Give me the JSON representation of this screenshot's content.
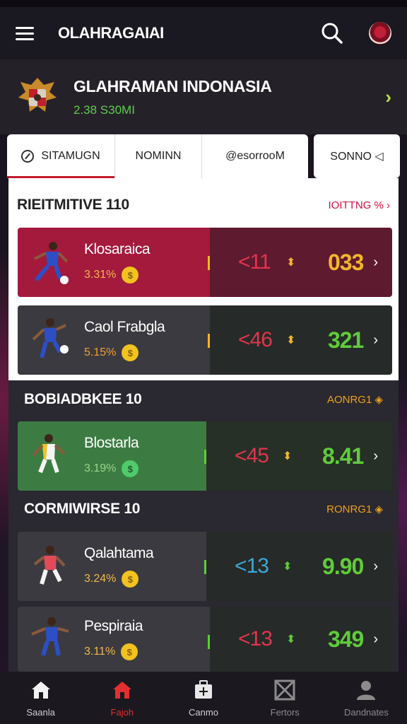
{
  "app": {
    "title": "OLAHRAGAIAI",
    "menu_icon": "menu-icon",
    "search_icon": "search-icon",
    "profile_icon": "profile-badge-icon"
  },
  "team": {
    "name": "GLAHRAMAN INDONASIA",
    "subtitle": "2.38 S30MI",
    "emblem_icon": "garuda-emblem-icon"
  },
  "tabs": [
    {
      "label": "SITAMUGN",
      "icon": "clock-icon",
      "active": true
    },
    {
      "label": "NOMINN",
      "active": false
    },
    {
      "label": "@esorrooM",
      "active": false
    }
  ],
  "tab_extra": {
    "label": "SONNO ◁"
  },
  "sections": [
    {
      "title": "RIEITMITIVE 110",
      "link": "IOITTNG % ›",
      "link_color": "#d0103a",
      "rows": [
        {
          "name": "Klosaraica",
          "pct": "3.31%",
          "coin": "$",
          "odds": "<11",
          "score": "033",
          "theme": "crimson"
        },
        {
          "name": "Caol Frabgla",
          "pct": "5.15%",
          "coin": "$",
          "odds": "<46",
          "score": "321",
          "theme": "slate"
        }
      ]
    },
    {
      "title": "BOBIADBKEE 10",
      "link": "AONRG1 ◈",
      "link_color": "#e9a21f",
      "rows": [
        {
          "name": "Blostarla",
          "pct": "3.19%",
          "coin": "$",
          "odds": "<45",
          "score": "8.41",
          "theme": "green"
        }
      ]
    },
    {
      "title": "CORMIWIRSE 10",
      "link": "RONRG1 ◈",
      "link_color": "#e9a21f",
      "rows": [
        {
          "name": "Qalahtama",
          "pct": "3.24%",
          "coin": "$",
          "odds": "<13",
          "score": "9.90",
          "theme": "slate"
        },
        {
          "name": "Pespiraia",
          "pct": "3.11%",
          "coin": "$",
          "odds": "<13",
          "score": "349",
          "theme": "slate"
        }
      ]
    }
  ],
  "bottom_nav": [
    {
      "label": "Saanla",
      "icon": "home-icon",
      "state": "normal"
    },
    {
      "label": "Fajoh",
      "icon": "home-icon",
      "state": "active"
    },
    {
      "label": "Canmo",
      "icon": "bag-icon",
      "state": "normal"
    },
    {
      "label": "Fertors",
      "icon": "grid-icon",
      "state": "dim"
    },
    {
      "label": "Dandnates",
      "icon": "user-icon",
      "state": "dim"
    }
  ],
  "colors": {
    "crimson_left": "#a31a3c",
    "crimson_right": "#5e1a2e",
    "slate_left": "#3b3a40",
    "slate_right": "#262a28",
    "green_left": "#3c7c43",
    "green_right": "#263026",
    "odds_red": "#e2354e",
    "odds_blue": "#3aa9d8",
    "score_yellow": "#f2b62b",
    "score_green": "#5fcc3a"
  }
}
